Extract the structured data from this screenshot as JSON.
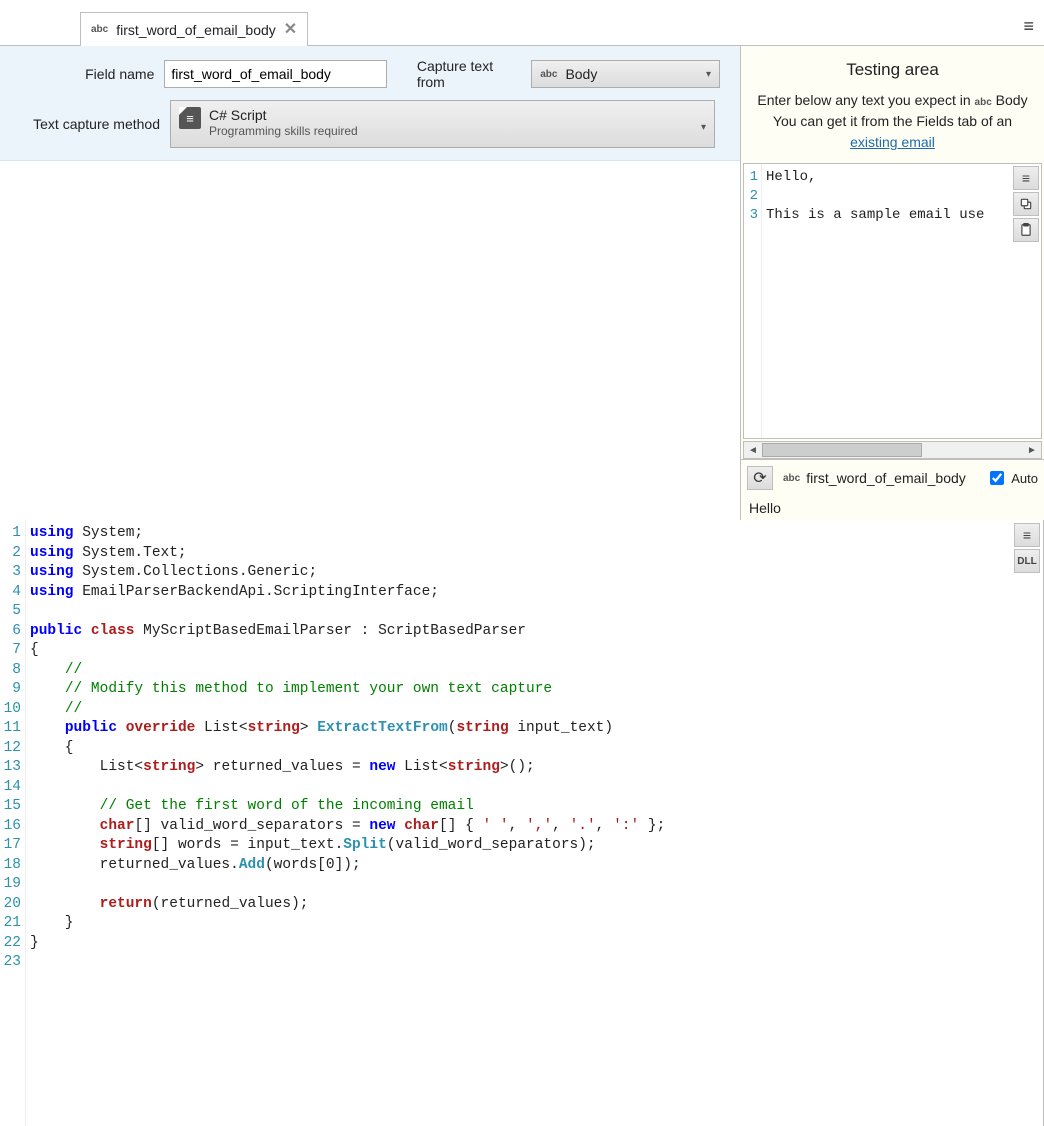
{
  "tab": {
    "prefix": "abc",
    "title": "first_word_of_email_body"
  },
  "form": {
    "field_name_label": "Field name",
    "field_name_value": "first_word_of_email_body",
    "capture_from_label": "Capture text from",
    "capture_from_prefix": "abc",
    "capture_from_value": "Body",
    "method_label": "Text capture method",
    "method_title": "C# Script",
    "method_sub": "Programming skills required"
  },
  "editor": {
    "tools": {
      "menu": "≡",
      "dll": "DLL"
    },
    "lines": [
      [
        [
          "kw",
          "using"
        ],
        [
          "",
          " System;"
        ]
      ],
      [
        [
          "kw",
          "using"
        ],
        [
          "",
          " System.Text;"
        ]
      ],
      [
        [
          "kw",
          "using"
        ],
        [
          "",
          " System.Collections.Generic;"
        ]
      ],
      [
        [
          "kw",
          "using"
        ],
        [
          "",
          " EmailParserBackendApi.ScriptingInterface;"
        ]
      ],
      [
        [
          "",
          ""
        ]
      ],
      [
        [
          "kw",
          "public"
        ],
        [
          "",
          " "
        ],
        [
          "kwred",
          "class"
        ],
        [
          "",
          " MyScriptBasedEmailParser : ScriptBasedParser"
        ]
      ],
      [
        [
          "",
          "{"
        ]
      ],
      [
        [
          "",
          "    "
        ],
        [
          "cmt",
          "//"
        ]
      ],
      [
        [
          "",
          "    "
        ],
        [
          "cmt",
          "// Modify this method to implement your own text capture"
        ]
      ],
      [
        [
          "",
          "    "
        ],
        [
          "cmt",
          "//"
        ]
      ],
      [
        [
          "",
          "    "
        ],
        [
          "kw",
          "public"
        ],
        [
          "",
          " "
        ],
        [
          "kwred",
          "override"
        ],
        [
          "",
          " List<"
        ],
        [
          "kwred",
          "string"
        ],
        [
          "",
          "> "
        ],
        [
          "type",
          "ExtractTextFrom"
        ],
        [
          "",
          "("
        ],
        [
          "kwred",
          "string"
        ],
        [
          "",
          " input_text)"
        ]
      ],
      [
        [
          "",
          "    {"
        ]
      ],
      [
        [
          "",
          "        List<"
        ],
        [
          "kwred",
          "string"
        ],
        [
          "",
          "> returned_values = "
        ],
        [
          "kw",
          "new"
        ],
        [
          "",
          " List<"
        ],
        [
          "kwred",
          "string"
        ],
        [
          "",
          ">();"
        ]
      ],
      [
        [
          "",
          ""
        ]
      ],
      [
        [
          "",
          "        "
        ],
        [
          "cmt",
          "// Get the first word of the incoming email"
        ]
      ],
      [
        [
          "",
          "        "
        ],
        [
          "kwred",
          "char"
        ],
        [
          "",
          "[] valid_word_separators = "
        ],
        [
          "kw",
          "new"
        ],
        [
          "",
          " "
        ],
        [
          "kwred",
          "char"
        ],
        [
          "",
          "[] { "
        ],
        [
          "str",
          "' '"
        ],
        [
          "",
          ", "
        ],
        [
          "str",
          "','"
        ],
        [
          "",
          ", "
        ],
        [
          "str",
          "'.'"
        ],
        [
          "",
          ", "
        ],
        [
          "str",
          "':'"
        ],
        [
          "",
          " };"
        ]
      ],
      [
        [
          "",
          "        "
        ],
        [
          "kwred",
          "string"
        ],
        [
          "",
          "[] words = input_text."
        ],
        [
          "type",
          "Split"
        ],
        [
          "",
          "(valid_word_separators);"
        ]
      ],
      [
        [
          "",
          "        returned_values."
        ],
        [
          "type",
          "Add"
        ],
        [
          "",
          "(words["
        ],
        [
          "",
          "0"
        ],
        [
          "",
          "]);"
        ]
      ],
      [
        [
          "",
          ""
        ]
      ],
      [
        [
          "",
          "        "
        ],
        [
          "kwred",
          "return"
        ],
        [
          "",
          "(returned_values);"
        ]
      ],
      [
        [
          "",
          "    }"
        ]
      ],
      [
        [
          "",
          "}"
        ]
      ],
      [
        [
          "",
          ""
        ]
      ]
    ]
  },
  "testing": {
    "title": "Testing area",
    "desc1_a": "Enter below any text you expect in ",
    "desc1_prefix": "abc",
    "desc1_b": " Body",
    "desc2": "You can get it from the Fields tab of an",
    "link": "existing email",
    "sample_lines": [
      "Hello,",
      "",
      "This is a sample email use"
    ],
    "tools": {
      "menu": "≡",
      "copy": "📋",
      "paste": "📄"
    },
    "result_prefix": "abc",
    "result_label": "first_word_of_email_body",
    "auto_label": "Auto",
    "output": "Hello"
  }
}
